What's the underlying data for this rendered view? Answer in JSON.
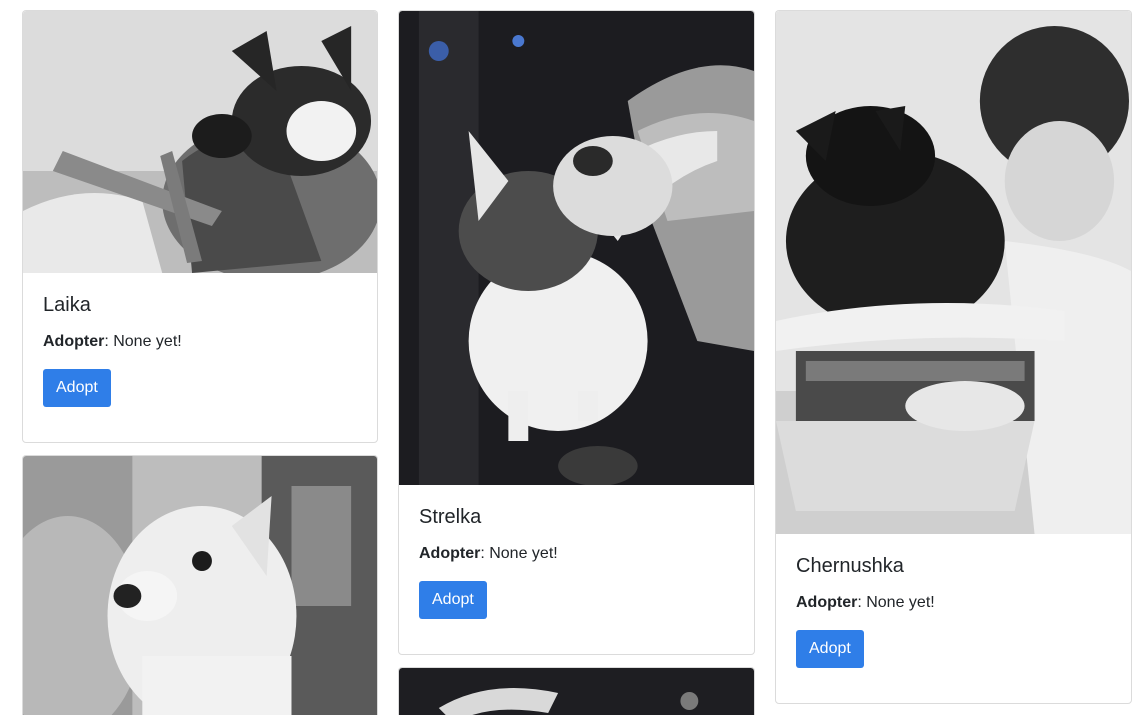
{
  "cards": [
    {
      "name": "Laika",
      "adopter_label": "Adopter",
      "adopter_value": ": None yet!",
      "button_label": "Adopt",
      "photo_icon": "dog-photo"
    },
    {
      "name": "Strelka",
      "adopter_label": "Adopter",
      "adopter_value": ": None yet!",
      "button_label": "Adopt",
      "photo_icon": "dog-photo"
    },
    {
      "name": "Chernushka",
      "adopter_label": "Adopter",
      "adopter_value": ": None yet!",
      "button_label": "Adopt",
      "photo_icon": "dog-photo"
    }
  ],
  "colors": {
    "button_bg": "#2f7ee8",
    "button_text": "#ffffff",
    "card_border": "#dcdcdc",
    "text": "#212529"
  }
}
